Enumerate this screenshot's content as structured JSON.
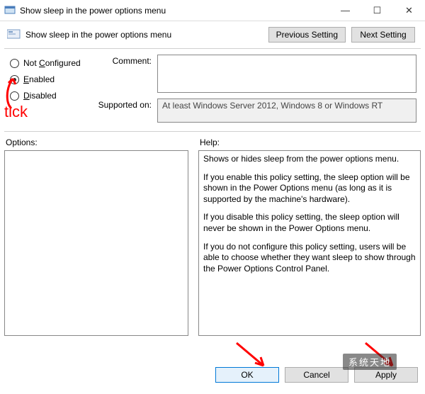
{
  "window": {
    "title": "Show sleep in the power options menu",
    "min_glyph": "—",
    "max_glyph": "☐",
    "close_glyph": "✕"
  },
  "header": {
    "title": "Show sleep in the power options menu",
    "prev_label": "Previous Setting",
    "next_label": "Next Setting"
  },
  "radios": {
    "not_configured_pre": "Not ",
    "not_configured_ul": "C",
    "not_configured_post": "onfigured",
    "enabled_ul": "E",
    "enabled_post": "nabled",
    "disabled_ul": "D",
    "disabled_post": "isabled",
    "selected": "enabled"
  },
  "fields": {
    "comment_label": "Comment:",
    "comment_value": "",
    "supported_label": "Supported on:",
    "supported_value": "At least Windows Server 2012, Windows 8 or Windows RT"
  },
  "columns": {
    "options_label": "Options:",
    "help_label": "Help:"
  },
  "help_paragraphs": [
    "Shows or hides sleep from the power options menu.",
    "If you enable this policy setting, the sleep option will be shown in the Power Options menu (as long as it is supported by the machine's hardware).",
    "If you disable this policy setting, the sleep option will never be shown in the Power Options menu.",
    "If you do not configure this policy setting, users will be able to choose whether they want sleep to show through the Power Options Control Panel."
  ],
  "footer": {
    "ok_label": "OK",
    "cancel_label": "Cancel",
    "apply_label": "Apply"
  },
  "annotations": {
    "tick_text": "tick",
    "watermark_text": "系统天地"
  }
}
